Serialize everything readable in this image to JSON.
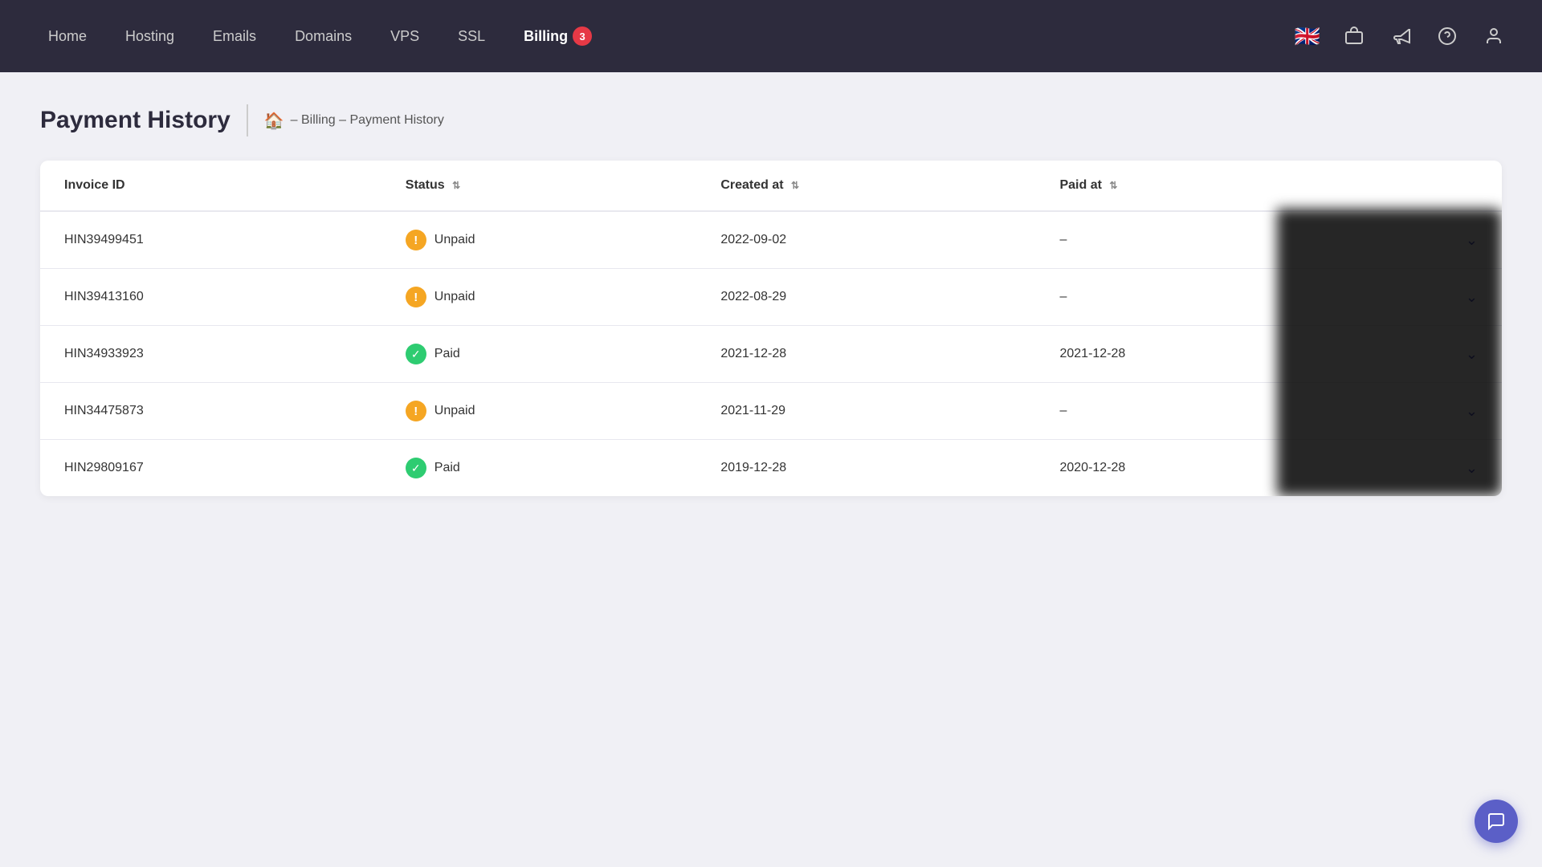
{
  "nav": {
    "links": [
      {
        "id": "home",
        "label": "Home",
        "active": false
      },
      {
        "id": "hosting",
        "label": "Hosting",
        "active": false
      },
      {
        "id": "emails",
        "label": "Emails",
        "active": false
      },
      {
        "id": "domains",
        "label": "Domains",
        "active": false
      },
      {
        "id": "vps",
        "label": "VPS",
        "active": false
      },
      {
        "id": "ssl",
        "label": "SSL",
        "active": false
      },
      {
        "id": "billing",
        "label": "Billing",
        "active": true,
        "badge": "3"
      }
    ],
    "icons": {
      "flag": "🇬🇧",
      "shop": "🏪",
      "megaphone": "📢",
      "help": "❓",
      "user": "👤"
    }
  },
  "page": {
    "title": "Payment History",
    "breadcrumb": {
      "home_icon": "🏠",
      "path": "– Billing – Payment History"
    }
  },
  "table": {
    "headers": [
      {
        "id": "invoice_id",
        "label": "Invoice ID",
        "sortable": false
      },
      {
        "id": "status",
        "label": "Status",
        "sortable": true
      },
      {
        "id": "created_at",
        "label": "Created at",
        "sortable": true
      },
      {
        "id": "paid_at",
        "label": "Paid at",
        "sortable": true
      },
      {
        "id": "actions",
        "label": "",
        "sortable": false
      }
    ],
    "rows": [
      {
        "id": "HIN39499451",
        "status": "Unpaid",
        "status_type": "unpaid",
        "created_at": "2022-09-02",
        "paid_at": "–"
      },
      {
        "id": "HIN39413160",
        "status": "Unpaid",
        "status_type": "unpaid",
        "created_at": "2022-08-29",
        "paid_at": "–"
      },
      {
        "id": "HIN34933923",
        "status": "Paid",
        "status_type": "paid",
        "created_at": "2021-12-28",
        "paid_at": "2021-12-28"
      },
      {
        "id": "HIN34475873",
        "status": "Unpaid",
        "status_type": "unpaid",
        "created_at": "2021-11-29",
        "paid_at": "–"
      },
      {
        "id": "HIN29809167",
        "status": "Paid",
        "status_type": "paid",
        "created_at": "2019-12-28",
        "paid_at": "2020-12-28"
      }
    ]
  },
  "colors": {
    "accent": "#5b5fc7",
    "unpaid": "#f5a623",
    "paid": "#2ecc71",
    "nav_bg": "#2d2b3d"
  }
}
